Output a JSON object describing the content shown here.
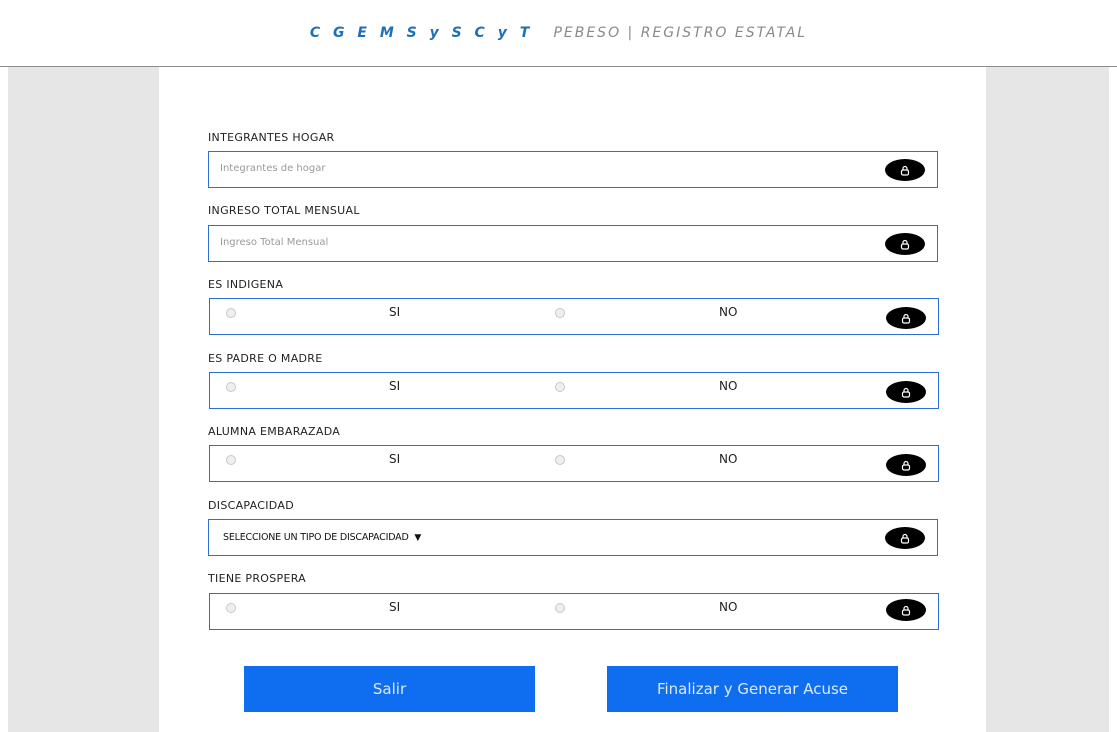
{
  "header": {
    "acronym": "C G E M S y S C y T",
    "subtitle": "PEBESO | REGISTRO ESTATAL"
  },
  "form": {
    "integrantes": {
      "label": "INTEGRANTES HOGAR",
      "placeholder": "Integrantes de hogar",
      "value": ""
    },
    "ingreso": {
      "label": "INGRESO TOTAL MENSUAL",
      "placeholder": "Ingreso Total Mensual",
      "value": ""
    },
    "indigena": {
      "label": "ES INDIGENA",
      "yes": "SI",
      "no": "NO"
    },
    "padre_madre": {
      "label": "ES PADRE O MADRE",
      "yes": "SI",
      "no": "NO"
    },
    "embarazada": {
      "label": "ALUMNA EMBARAZADA",
      "yes": "SI",
      "no": "NO"
    },
    "discapacidad": {
      "label": "DISCAPACIDAD",
      "selected": "SELECCIONE UN TIPO DE DISCAPACIDAD"
    },
    "prospera": {
      "label": "TIENE PROSPERA",
      "yes": "SI",
      "no": "NO"
    }
  },
  "buttons": {
    "exit": "Salir",
    "finish": "Finalizar y Generar Acuse"
  },
  "icons": {
    "lock": "lock-icon",
    "dropdown": "caret-down-icon"
  },
  "colors": {
    "accent": "#0f6ef0",
    "border": "#2b6fd6",
    "brand": "#1f6fb5"
  }
}
